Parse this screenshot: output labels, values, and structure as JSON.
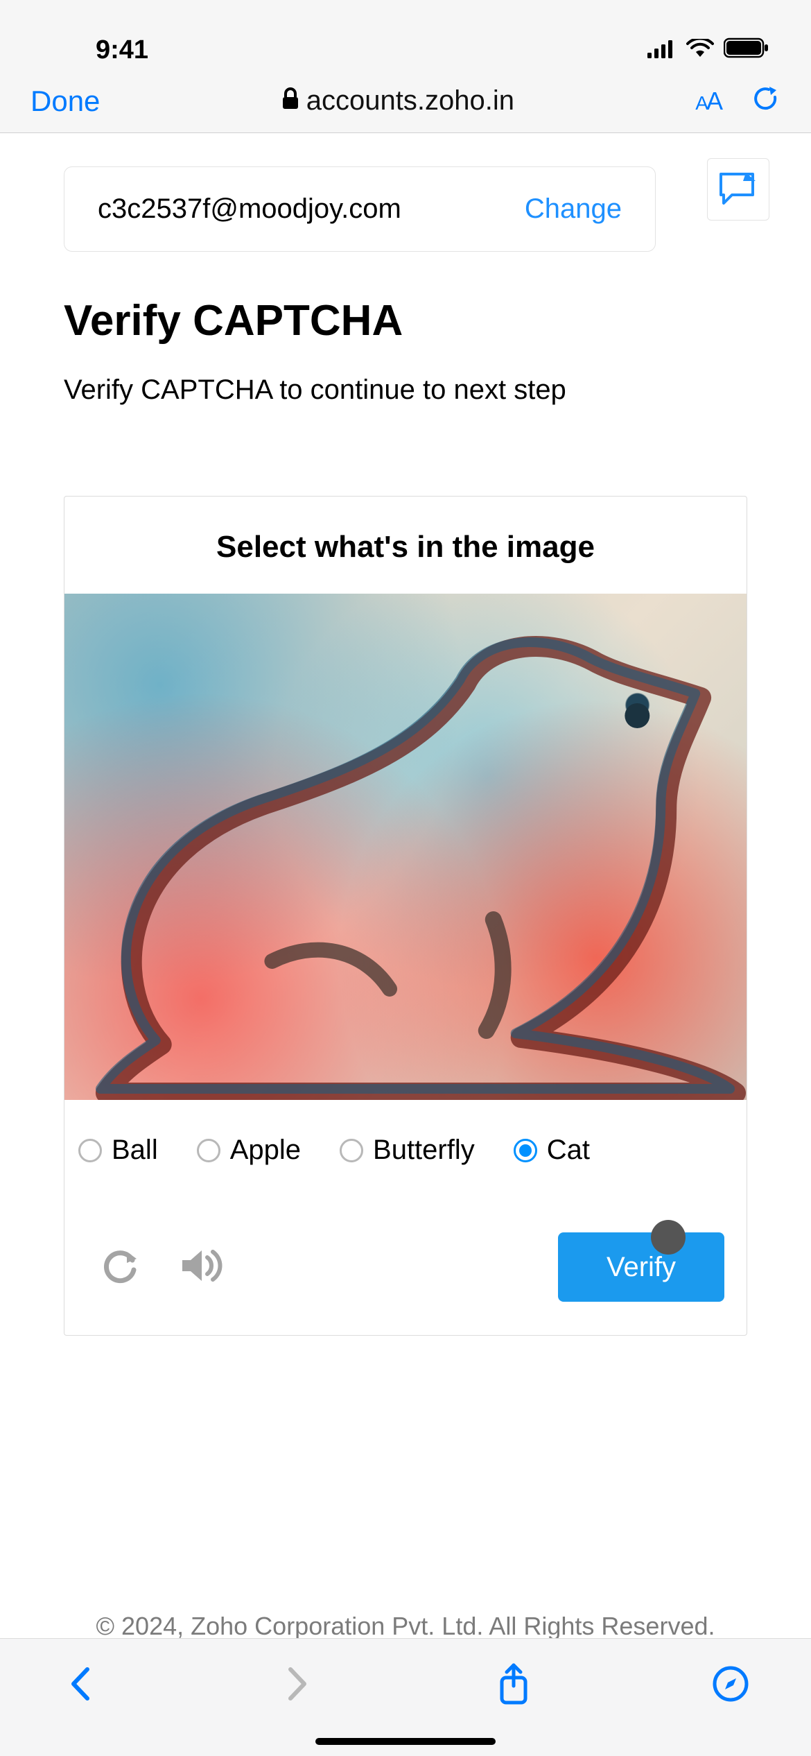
{
  "status": {
    "time": "9:41"
  },
  "browser": {
    "done_label": "Done",
    "url_host": "accounts.zoho.in"
  },
  "account": {
    "email": "c3c2537f@moodjoy.com",
    "change_label": "Change"
  },
  "page": {
    "title": "Verify CAPTCHA",
    "subtitle": "Verify CAPTCHA to continue to next step"
  },
  "captcha": {
    "instruction": "Select what's in the image",
    "options": [
      "Ball",
      "Apple",
      "Butterfly",
      "Cat"
    ],
    "selected": "Cat",
    "verify_label": "Verify"
  },
  "footer": {
    "copyright": "© 2024, Zoho Corporation Pvt. Ltd. All Rights Reserved."
  }
}
